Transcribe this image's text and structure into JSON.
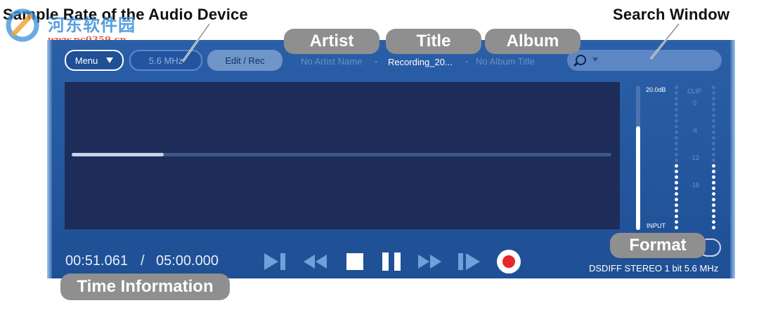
{
  "annotations": {
    "sample_rate": "Sample Rate of the Audio Device",
    "search_window": "Search Window",
    "artist": "Artist",
    "title": "Title",
    "album": "Album",
    "format": "Format",
    "time_information": "Time Information"
  },
  "watermark": {
    "text": "河东软件园",
    "url": "www.pc0359.cn"
  },
  "toolbar": {
    "menu_label": "Menu",
    "sample_rate_value": "5.6 MHz",
    "edit_rec_label": "Edit / Rec",
    "artist_value": "No Artist Name",
    "title_value": "Recording_20...",
    "album_value": "No Album Title",
    "separator": "·"
  },
  "playback": {
    "progress": 0.17
  },
  "meter": {
    "peak_label": "20.0dB",
    "clip_label": "CLIP",
    "scale": [
      "0",
      "-6",
      "-12",
      "-18"
    ],
    "input_label": "INPUT",
    "level": 0.72
  },
  "time": {
    "elapsed": "00:51.061",
    "divider": "/",
    "total": "05:00.000"
  },
  "format_value": "DSDIFF STEREO 1 bit 5.6 MHz",
  "colors": {
    "panel": "#2559a0",
    "waveform_bg": "#1e2c5a",
    "callout": "#8f8f8f",
    "record": "#e8252a",
    "control_icons": "#6fa0da"
  }
}
